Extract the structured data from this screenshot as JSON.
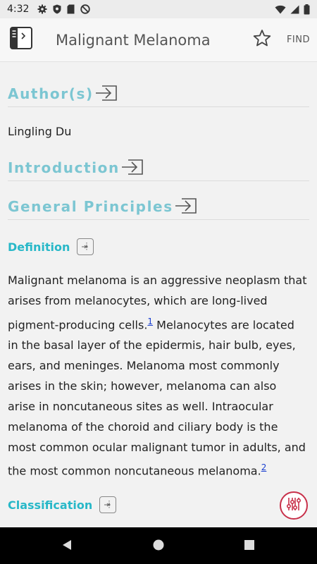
{
  "status_bar": {
    "time": "4:32"
  },
  "app_bar": {
    "title": "Malignant Melanoma",
    "find_label": "FIND"
  },
  "sections": {
    "authors": "Author(s)",
    "introduction": "Introduction",
    "general_principles": "General Principles"
  },
  "author_name": "Lingling Du",
  "subsections": {
    "definition": "Definition",
    "classification": "Classification"
  },
  "definition_text": {
    "part1": "Malignant melanoma is an aggressive neoplasm that arises from melanocytes, which are long-lived pigment-producing cells.",
    "ref1": "1",
    "part2": " Melanocytes are located in the basal layer of the epidermis, hair bulb, eyes, ears, and meninges. Melanoma most commonly arises in the skin; however, melanoma can also arise in noncutaneous sites as well. Intraocular melanoma of the choroid and ciliary body is the most common ocular malignant tumor in adults, and the most common noncutaneous melanoma.",
    "ref2": "2"
  },
  "colors": {
    "section_heading": "#7cc6d2",
    "subsection_heading": "#28b8c8",
    "fab_accent": "#c8304a",
    "link": "#1a3fd0"
  },
  "icons": {
    "book": "book-toc-icon",
    "star": "star-outline-icon",
    "section_arrow": "jump-to-section-icon",
    "outline": "outline-icon",
    "fab": "sliders-icon"
  }
}
